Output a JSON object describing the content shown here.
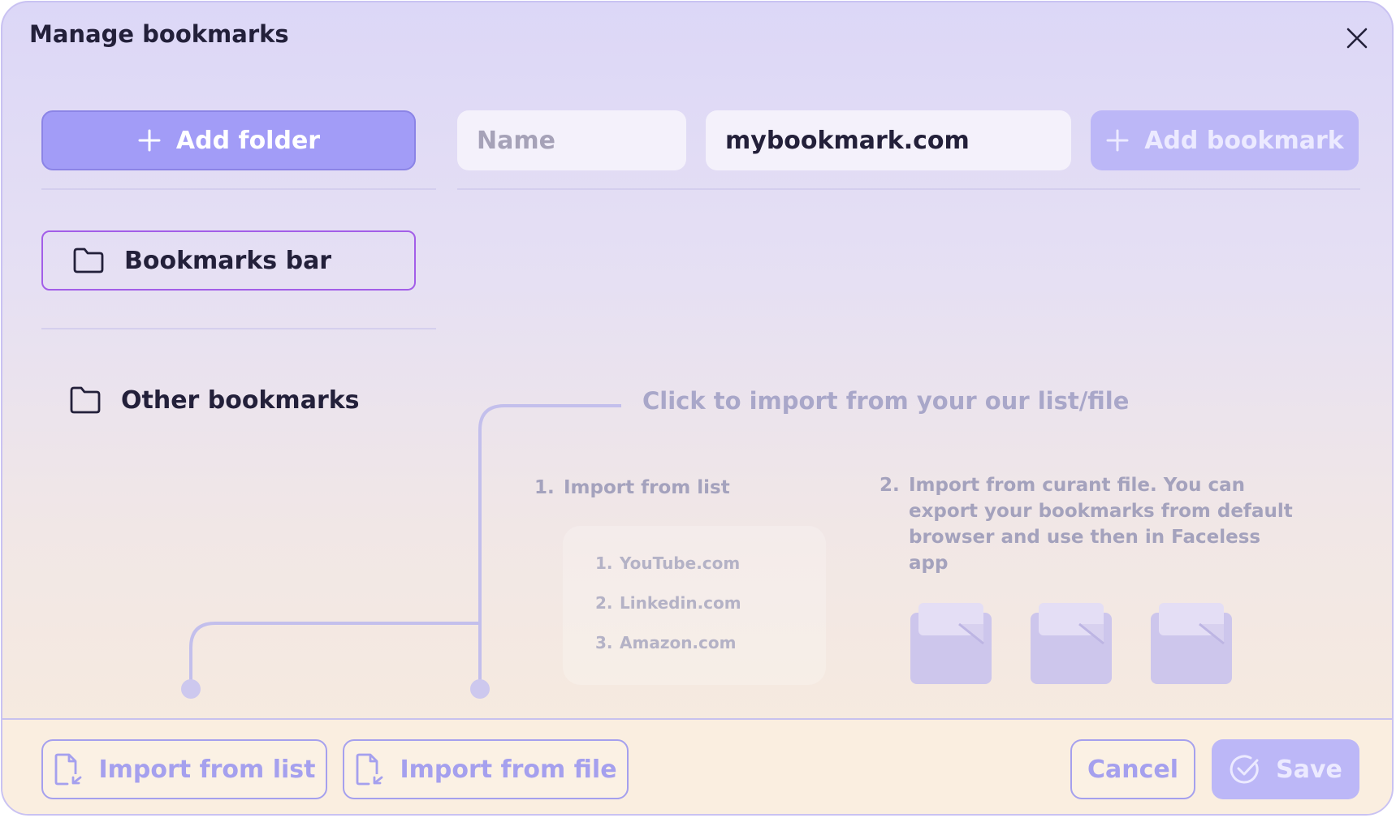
{
  "dialog": {
    "title": "Manage bookmarks"
  },
  "toolbar": {
    "add_folder_label": "Add folder",
    "name_placeholder": "Name",
    "url_value": "mybookmark.com",
    "add_bookmark_label": "Add bookmark"
  },
  "folders": [
    {
      "label": "Bookmarks bar",
      "selected": true
    },
    {
      "label": "Other bookmarks",
      "selected": false
    }
  ],
  "import_hint": {
    "title": "Click to import from your our list/file",
    "step1": {
      "num": "1.",
      "text": "Import from list"
    },
    "step2": {
      "num": "2.",
      "line1": "Import from  curant file. You can",
      "line2": "export your bookmarks from default",
      "line3": "browser and use then in Faceless app"
    },
    "sample_list": [
      {
        "num": "1.",
        "text": "YouTube.com"
      },
      {
        "num": "2.",
        "text": "Linkedin.com"
      },
      {
        "num": "3.",
        "text": "Amazon.com"
      }
    ]
  },
  "footer": {
    "import_list_label": "Import from list",
    "import_file_label": "Import from file",
    "cancel_label": "Cancel",
    "save_label": "Save"
  },
  "icons": {
    "close": "close-icon",
    "plus": "plus-icon",
    "folder": "folder-icon",
    "file_import": "file-import-icon",
    "check_circle": "check-circle-icon",
    "file": "file-icon"
  },
  "colors": {
    "primary": "#a29cf7",
    "primary_disabled": "#bcb7f7",
    "selected_border": "#a35ee8",
    "text_dark": "#23203a",
    "muted": "#a4a2bd",
    "footer_bg": "#faeee0"
  }
}
